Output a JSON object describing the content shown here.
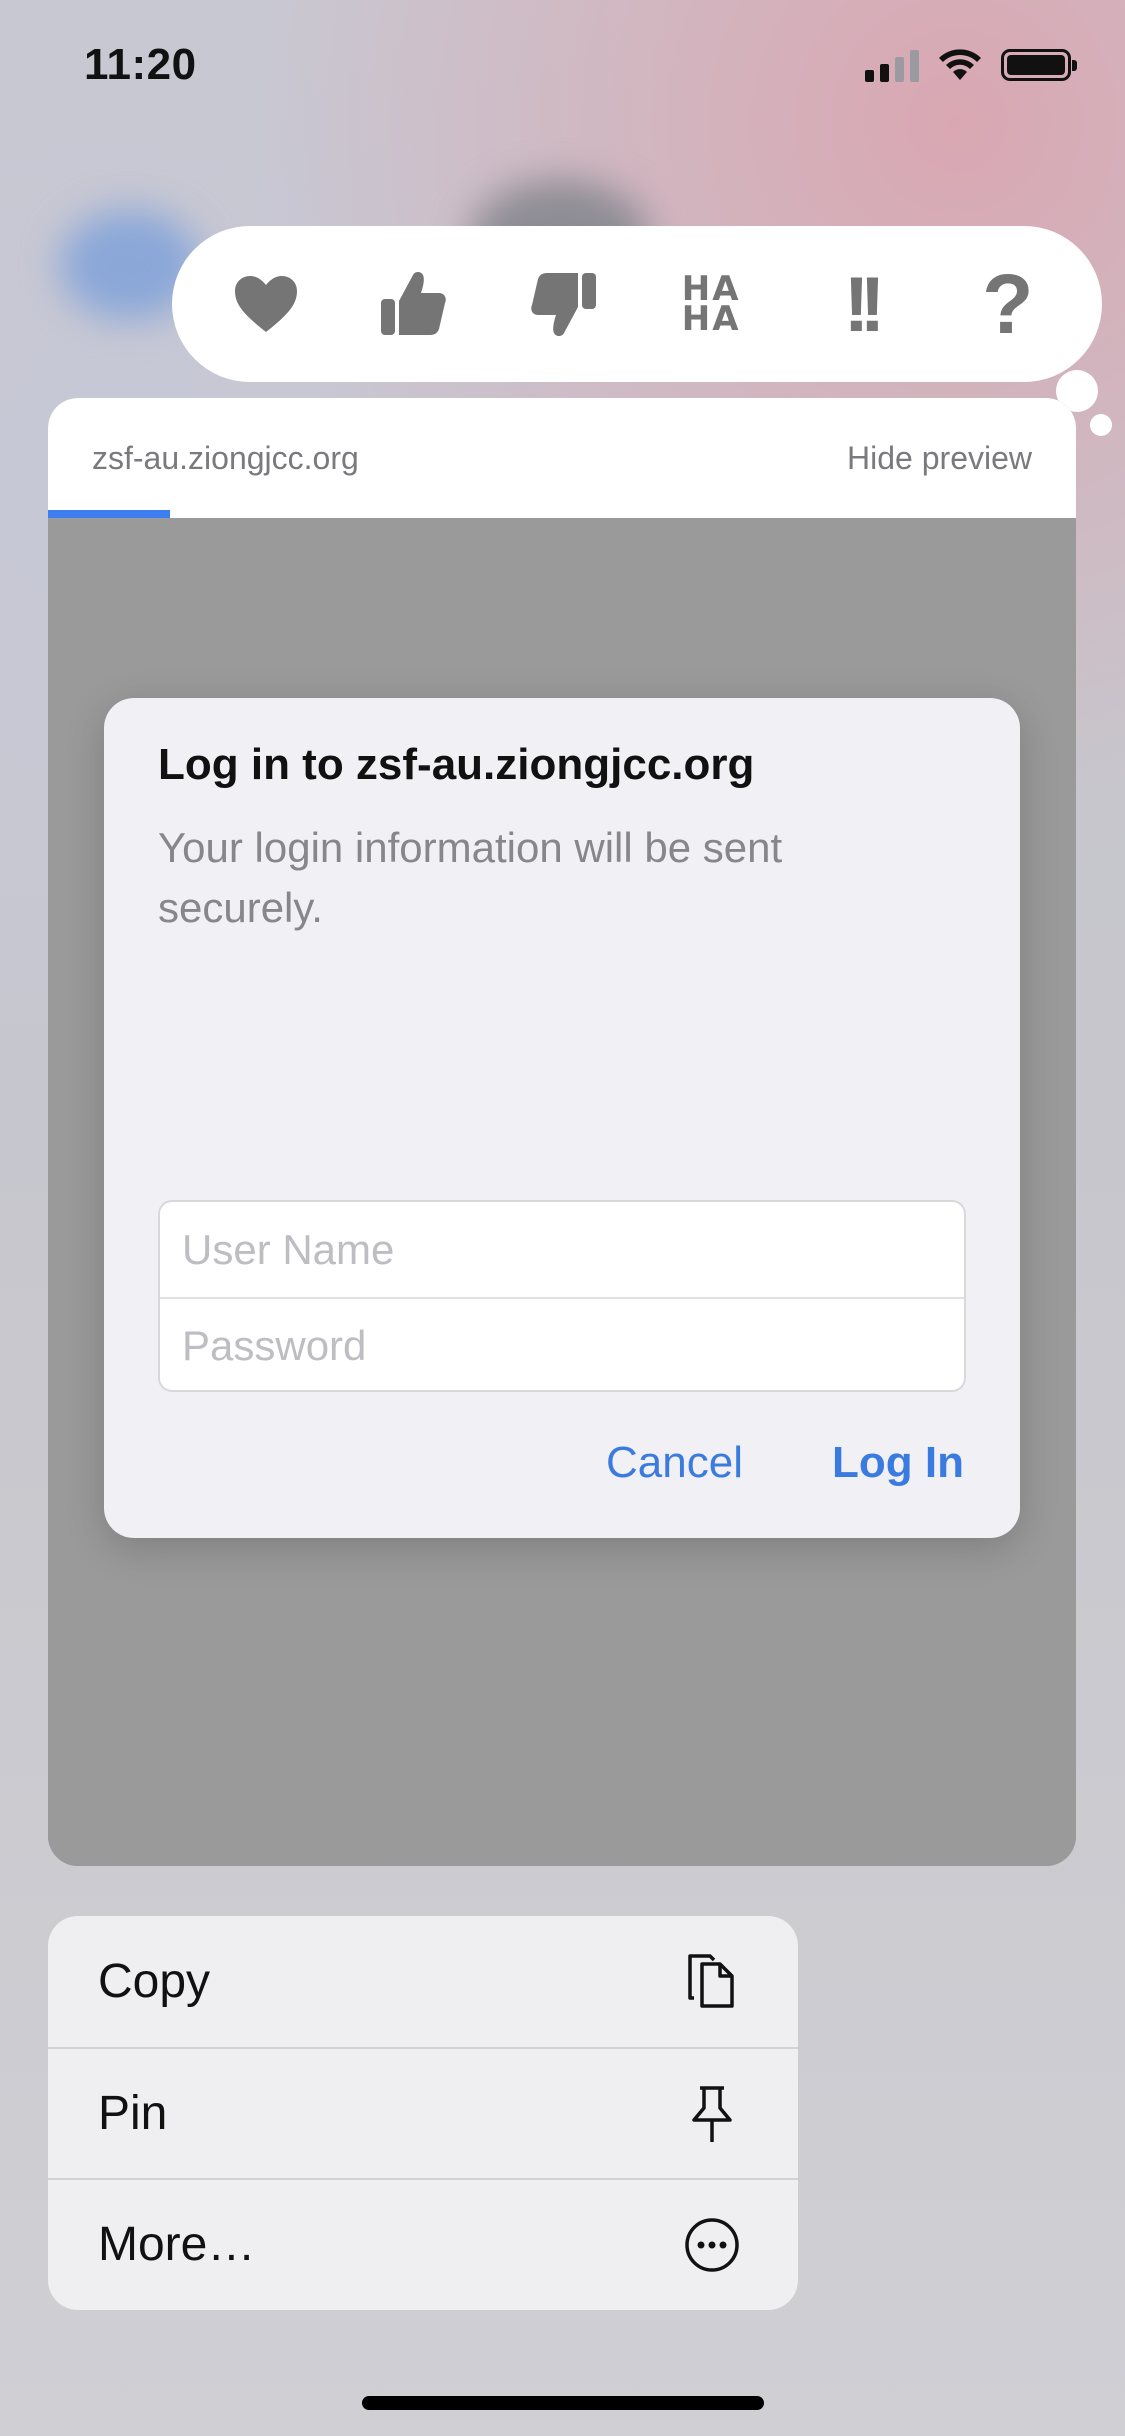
{
  "status_bar": {
    "time": "11:20"
  },
  "tapback": {
    "items": [
      {
        "icon": "heart-icon"
      },
      {
        "icon": "thumbs-up-icon"
      },
      {
        "icon": "thumbs-down-icon"
      },
      {
        "icon": "haha-icon",
        "line1": "HA",
        "line2": "HA"
      },
      {
        "icon": "exclamation-icon",
        "text": "!!"
      },
      {
        "icon": "question-icon",
        "text": "?"
      }
    ]
  },
  "preview": {
    "url": "zsf-au.ziongjcc.org",
    "hide_label": "Hide preview"
  },
  "dialog": {
    "title": "Log in to zsf-au.ziongjcc.org",
    "message": "Your login information will be sent securely.",
    "username_placeholder": "User Name",
    "password_placeholder": "Password",
    "cancel_label": "Cancel",
    "login_label": "Log In"
  },
  "menu": {
    "items": [
      {
        "label": "Copy",
        "icon": "copy-icon"
      },
      {
        "label": "Pin",
        "icon": "pin-icon"
      },
      {
        "label": "More…",
        "icon": "more-icon"
      }
    ]
  },
  "colors": {
    "accent": "#3a7be0",
    "progress": "#3d7ef1",
    "tapback_icon": "#757575"
  }
}
